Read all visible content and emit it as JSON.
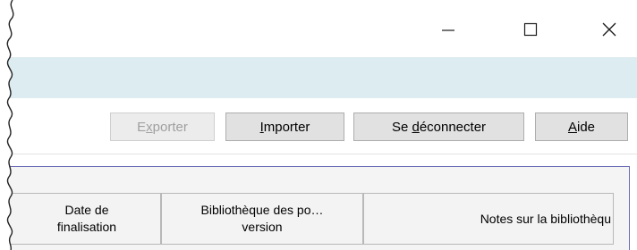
{
  "window": {
    "controls": {
      "minimize": "minimize-icon",
      "maximize": "maximize-icon",
      "close": "close-icon"
    }
  },
  "toolbar": {
    "exporter": {
      "before": "E",
      "mnemonic": "x",
      "after": "porter",
      "enabled": false
    },
    "importer": {
      "before": "",
      "mnemonic": "I",
      "after": "mporter",
      "enabled": true
    },
    "deconnecter": {
      "before": "Se ",
      "mnemonic": "d",
      "after": "éconnecter",
      "enabled": true
    },
    "aide": {
      "before": "",
      "mnemonic": "A",
      "after": "ide",
      "enabled": true
    }
  },
  "table": {
    "columns": [
      {
        "line1": "Date de",
        "line2": "finalisation"
      },
      {
        "line1": "Bibliothèque des po…",
        "line2": "version"
      },
      {
        "line1": "Notes sur la bibliothèqu",
        "line2": ""
      }
    ]
  },
  "colors": {
    "ribbon": "#dcecf1",
    "panel_border": "#6b6bb5"
  }
}
